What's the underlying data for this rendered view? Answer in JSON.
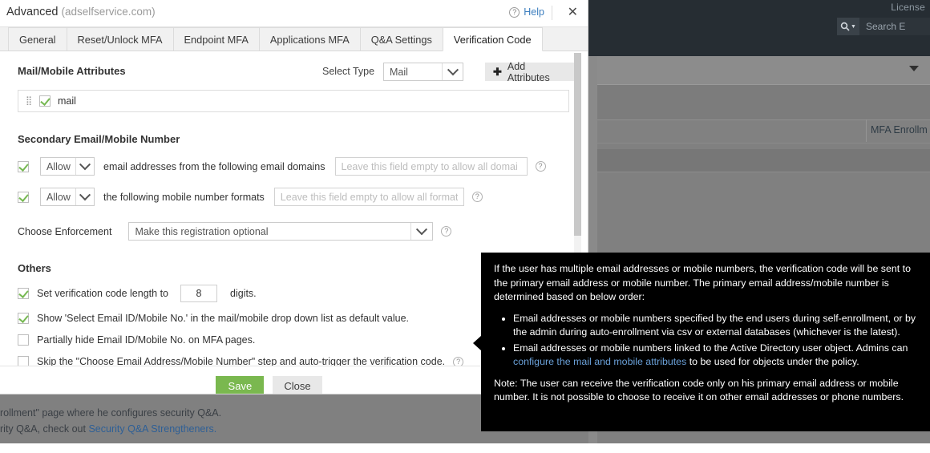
{
  "background": {
    "license_label": "License",
    "search_placeholder": "Search E",
    "search_icon": "search-icon",
    "column_header": "MFA Enrollm",
    "bottom_lines": [
      "rollment\" page where he configures security Q&A.",
      "rity Q&A, check out ",
      "Security Q&A Strengtheners."
    ]
  },
  "dialog": {
    "title": "Advanced",
    "domain": "(adselfservice.com)",
    "help_label": "Help",
    "help_icon": "question-circle-icon",
    "close_icon": "close-icon",
    "tabs": [
      {
        "label": "General",
        "active": false
      },
      {
        "label": "Reset/Unlock MFA",
        "active": false
      },
      {
        "label": "Endpoint MFA",
        "active": false
      },
      {
        "label": "Applications MFA",
        "active": false
      },
      {
        "label": "Q&A Settings",
        "active": false
      },
      {
        "label": "Verification Code",
        "active": true
      }
    ],
    "attributes_section": {
      "title": "Mail/Mobile Attributes",
      "select_type_label": "Select Type",
      "select_type_value": "Mail",
      "add_attributes_label": "Add Attributes",
      "add_icon": "plus-icon",
      "rows": [
        {
          "name": "mail",
          "checked": true,
          "drag_icon": "drag-handle-icon"
        }
      ]
    },
    "secondary_section": {
      "title": "Secondary Email/Mobile Number",
      "email_rule": {
        "checked": true,
        "mode": "Allow",
        "text": "email addresses from the following email domains",
        "placeholder": "Leave this field empty to allow all domai",
        "value": ""
      },
      "mobile_rule": {
        "checked": true,
        "mode": "Allow",
        "text": "the following mobile number formats",
        "placeholder": "Leave this field empty to allow all format",
        "value": ""
      },
      "enforcement_label": "Choose Enforcement",
      "enforcement_value": "Make this registration optional"
    },
    "others_section": {
      "title": "Others",
      "code_length": {
        "checked": true,
        "label": "Set verification code length to",
        "value": "8",
        "suffix": "digits."
      },
      "checkboxes": [
        {
          "checked": true,
          "label": "Show 'Select Email ID/Mobile No.' in the mail/mobile drop down list as default value.",
          "has_help": false
        },
        {
          "checked": false,
          "label": "Partially hide Email ID/Mobile No. on MFA pages.",
          "has_help": false
        },
        {
          "checked": false,
          "label": "Skip the \"Choose Email Address/Mobile Number\" step and auto-trigger the verification code.",
          "has_help": true
        }
      ]
    },
    "footer": {
      "save_label": "Save",
      "close_label": "Close"
    }
  },
  "tooltip": {
    "intro": "If the user has multiple email addresses or mobile numbers, the verification code will be sent to the primary email address or mobile number. The primary email address/mobile number is determined based on below order:",
    "bullet1": "Email addresses or mobile numbers specified by the end users during self-enrollment, or by the admin during auto-enrollment via csv or external databases (whichever is the latest).",
    "bullet2_pre": "Email addresses or mobile numbers linked to the Active Directory user object. Admins can ",
    "bullet2_link": "configure the mail and mobile attributes",
    "bullet2_post": " to be used for objects under the policy.",
    "note": "Note: The user can receive the verification code only on his primary email address or mobile number. It is not possible to choose to receive it on other email addresses or phone numbers."
  },
  "colors": {
    "accent_green": "#7ab84f",
    "link_blue": "#3c7ebf",
    "tooltip_bg": "#000000",
    "header_dark": "#262d33"
  }
}
